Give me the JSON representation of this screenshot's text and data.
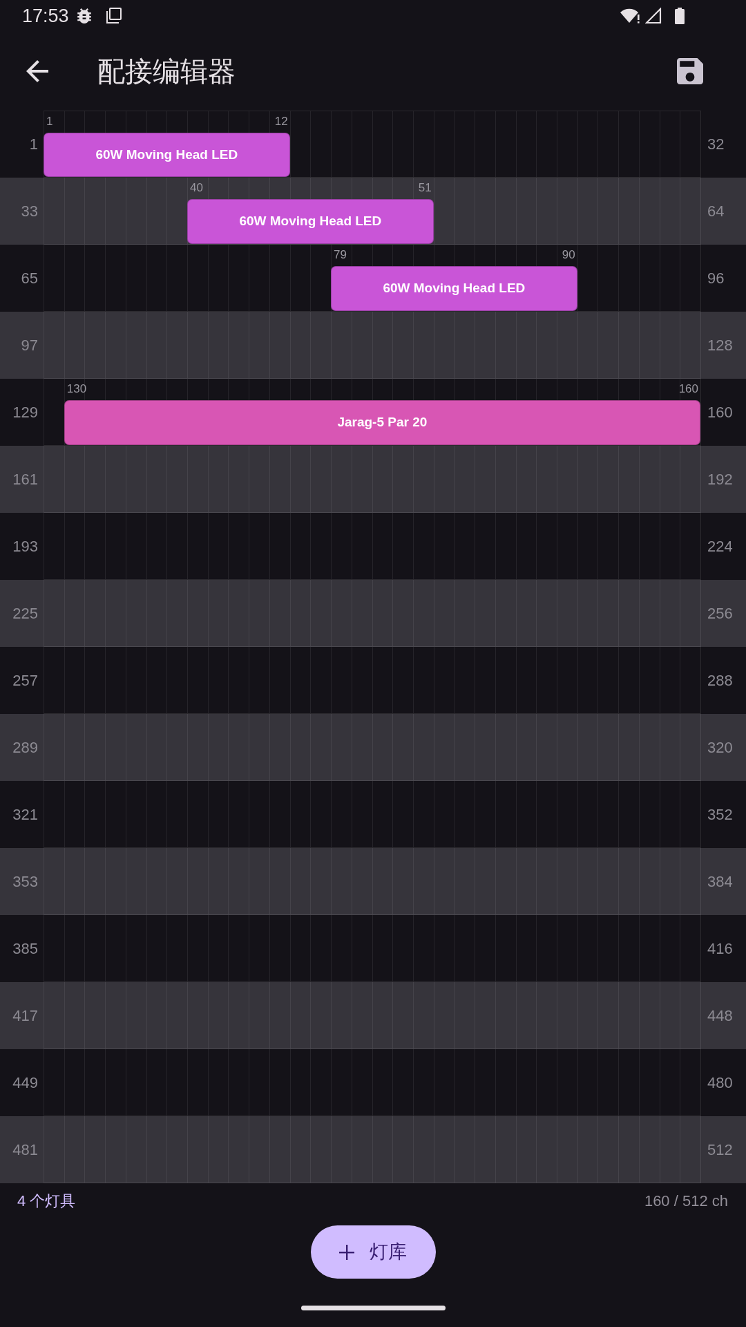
{
  "status_bar": {
    "time": "17:53"
  },
  "app_bar": {
    "title": "配接编辑器"
  },
  "grid": {
    "rows": [
      {
        "start": "1",
        "end": "32"
      },
      {
        "start": "33",
        "end": "64"
      },
      {
        "start": "65",
        "end": "96"
      },
      {
        "start": "97",
        "end": "128"
      },
      {
        "start": "129",
        "end": "160"
      },
      {
        "start": "161",
        "end": "192"
      },
      {
        "start": "193",
        "end": "224"
      },
      {
        "start": "225",
        "end": "256"
      },
      {
        "start": "257",
        "end": "288"
      },
      {
        "start": "289",
        "end": "320"
      },
      {
        "start": "321",
        "end": "352"
      },
      {
        "start": "353",
        "end": "384"
      },
      {
        "start": "385",
        "end": "416"
      },
      {
        "start": "417",
        "end": "448"
      },
      {
        "start": "449",
        "end": "480"
      },
      {
        "start": "481",
        "end": "512"
      }
    ]
  },
  "fixtures": [
    {
      "name": "60W Moving Head LED",
      "start": "1",
      "end": "12",
      "color": "#c955d7"
    },
    {
      "name": "60W Moving Head LED",
      "start": "40",
      "end": "51",
      "color": "#c955d7"
    },
    {
      "name": "60W Moving Head LED",
      "start": "79",
      "end": "90",
      "color": "#c955d7"
    },
    {
      "name": "Jarag-5 Par 20",
      "start": "130",
      "end": "160",
      "color": "#d856b4"
    }
  ],
  "footer": {
    "fixture_count": "4 个灯具",
    "usage": "160 / 512 ch"
  },
  "fab": {
    "label": "灯库"
  }
}
